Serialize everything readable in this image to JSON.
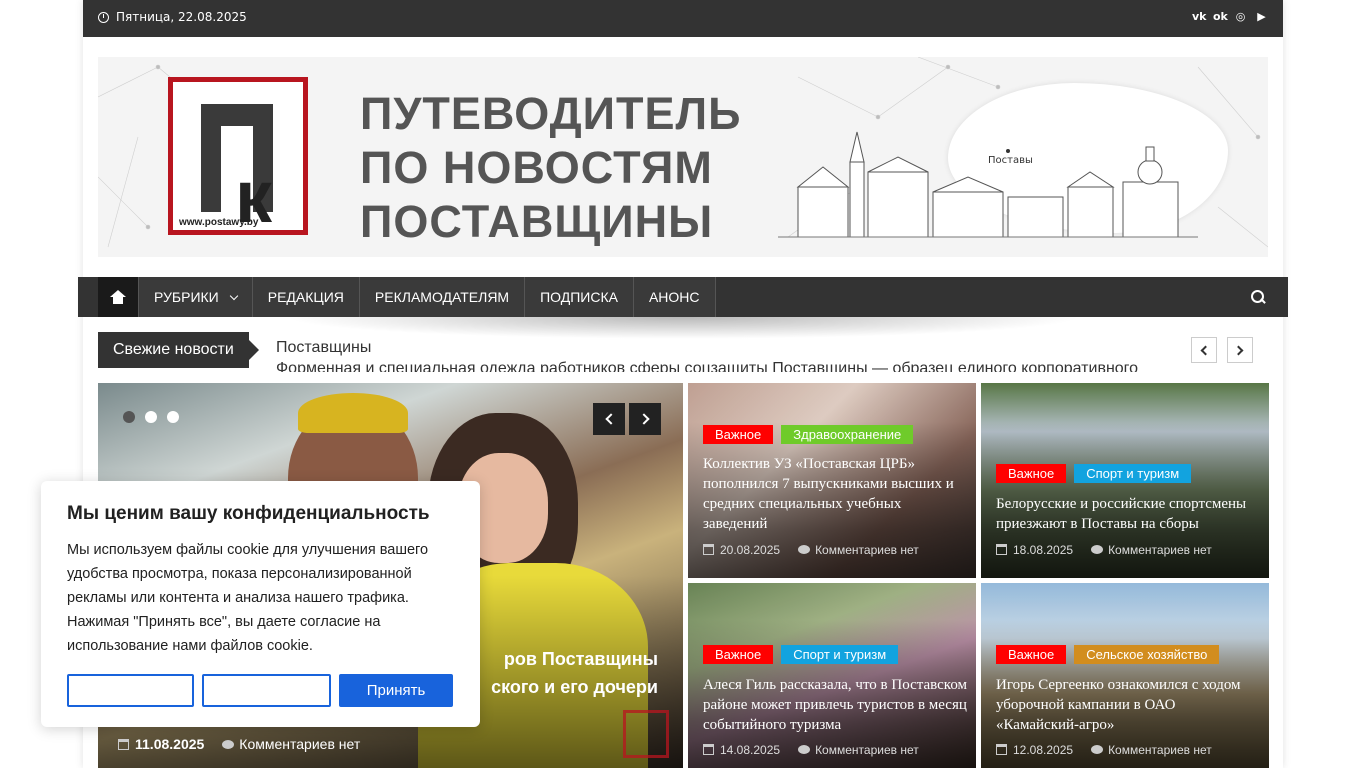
{
  "topbar": {
    "date": "Пятница, 22.08.2025",
    "social": [
      "vk-icon",
      "odnoklassniki-icon",
      "instagram-icon",
      "youtube-icon"
    ]
  },
  "banner": {
    "logo_url": "www.postawy.by",
    "title_lines": [
      "ПУТЕВОДИТЕЛЬ",
      "ПО НОВОСТЯМ",
      "ПОСТАВЩИНЫ"
    ],
    "map_label": "Поставы"
  },
  "nav": {
    "items": [
      "РУБРИКИ",
      "РЕДАКЦИЯ",
      "РЕКЛАМОДАТЕЛЯМ",
      "ПОДПИСКА",
      "АНОНС"
    ]
  },
  "ticker": {
    "label": "Свежие новости",
    "line1": "Поставщины",
    "line2": "Форменная и специальная одежда работников сферы соцзащиты Поставщины — образец единого корпоративного"
  },
  "slider": {
    "title_line1": "ров Поставщины",
    "title_line2": "ского и его дочери",
    "date": "11.08.2025",
    "comments": "Комментариев нет"
  },
  "cards": [
    {
      "tags": [
        {
          "label": "Важное",
          "color": "#ff0000"
        },
        {
          "label": "Здравоохранение",
          "color": "#6fcb2a"
        }
      ],
      "title": "Коллектив УЗ «Поставская ЦРБ» пополнился 7 выпускниками высших и средних специальных учебных заведений",
      "date": "20.08.2025",
      "comments": "Комментариев нет"
    },
    {
      "tags": [
        {
          "label": "Важное",
          "color": "#ff0000"
        },
        {
          "label": "Спорт и туризм",
          "color": "#12a3df"
        }
      ],
      "title": "Белорусские и российские спортсмены приезжают в Поставы на сборы",
      "date": "18.08.2025",
      "comments": "Комментариев нет"
    },
    {
      "tags": [
        {
          "label": "Важное",
          "color": "#ff0000"
        },
        {
          "label": "Спорт и туризм",
          "color": "#12a3df"
        }
      ],
      "title": "Алеся Гиль рассказала, что в Поставском районе может привлечь туристов в месяц событийного туризма",
      "date": "14.08.2025",
      "comments": "Комментариев нет"
    },
    {
      "tags": [
        {
          "label": "Важное",
          "color": "#ff0000"
        },
        {
          "label": "Сельское хозяйство",
          "color": "#d28d1e"
        }
      ],
      "title": "Игорь Сергеенко ознакомился с ходом уборочной кампании в ОАО «Камайский-агро»",
      "date": "12.08.2025",
      "comments": "Комментариев нет"
    }
  ],
  "cookie": {
    "title": "Мы ценим вашу конфиденциальность",
    "text": "Мы используем файлы cookie для улучшения вашего удобства просмотра, показа персонализированной рекламы или контента и анализа нашего трафика. Нажимая \"Принять все\", вы даете согласие на использование нами файлов cookie.",
    "btn_customize": "",
    "btn_reject": "",
    "btn_accept": "Принять"
  },
  "colors": {
    "dark": "#333333",
    "tag_red": "#ff0000",
    "cookie_blue": "#1863dc",
    "logo_red": "#b8151f"
  }
}
